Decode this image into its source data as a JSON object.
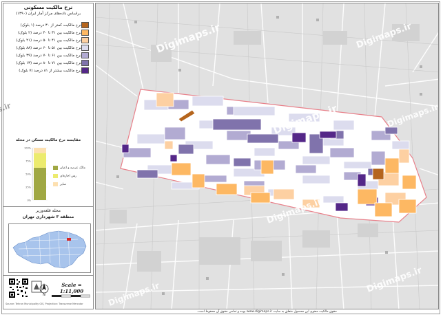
{
  "legend": {
    "title": "نرخ مالکیت مسکونی",
    "subtitle": "براساس داده‌های مرکز آمار ایران (۱۳۹۰)",
    "items": [
      {
        "label": "نرخ مالکیت کمتر از ۳۰ درصد (۱ بلوک)",
        "color": "#b5651d"
      },
      {
        "label": "نرخ مالکیت بین ۳۱ تا ۴۰ درصد (۲ بلوک)",
        "color": "#fdb863"
      },
      {
        "label": "نرخ مالکیت بین ۴۱ تا ۵۰ درصد (۲۱ بلوک)",
        "color": "#fdd0a2"
      },
      {
        "label": "نرخ مالکیت بین ۵۱ تا ۶۰ درصد (۸۸ بلوک)",
        "color": "#dcdcee"
      },
      {
        "label": "نرخ مالکیت بین ۶۱ تا ۷۰ درصد (۳۹ بلوک)",
        "color": "#b2abd2"
      },
      {
        "label": "نرخ مالکیت بین ۷۱ تا ۸۰ درصد (۱۳ بلوک)",
        "color": "#8073ac"
      },
      {
        "label": "نرخ مالکیت بیشتر از ۸۱ درصد (۷ بلوک)",
        "color": "#542788"
      }
    ]
  },
  "chart": {
    "title": "مقایسه نرخ مالکیت مسکن در محله",
    "legend": [
      {
        "label": "مالک عرصه و اعیان",
        "color": "#a0a843"
      },
      {
        "label": "رهن اجاره‌ای",
        "color": "#eceb6e"
      },
      {
        "label": "سایر",
        "color": "#fde0b0"
      }
    ]
  },
  "chart_data": {
    "type": "bar",
    "categories": [
      "محله"
    ],
    "series": [
      {
        "name": "مالک عرصه و اعیان",
        "values": [
          62
        ]
      },
      {
        "name": "رهن اجاره‌ای",
        "values": [
          28
        ]
      },
      {
        "name": "سایر",
        "values": [
          10
        ]
      }
    ],
    "stacked": true,
    "ylim": [
      0,
      100
    ],
    "yticks": [
      "0%",
      "25%",
      "50%",
      "75%",
      "100%"
    ]
  },
  "place": {
    "neighborhood": "محله قلعه‌وزیر",
    "district": "منطقه ۳ شهرداری تهران"
  },
  "scale_text": "Scale = 1:11,000",
  "watermark": "Digimaps.ir",
  "credit_small": "Source: Tehran Municipality GIS, Projection: Transverse Mercator",
  "footer": "حقوق مالکیت معنوی این محصول متعلق به سایت www.digimaps.ir بوده و تمامی حقوق آن محفوظ است.",
  "colors": {
    "boundary": "#e8808a",
    "district_fill": "#a8c4ec",
    "district_highlight": "#d62728"
  }
}
